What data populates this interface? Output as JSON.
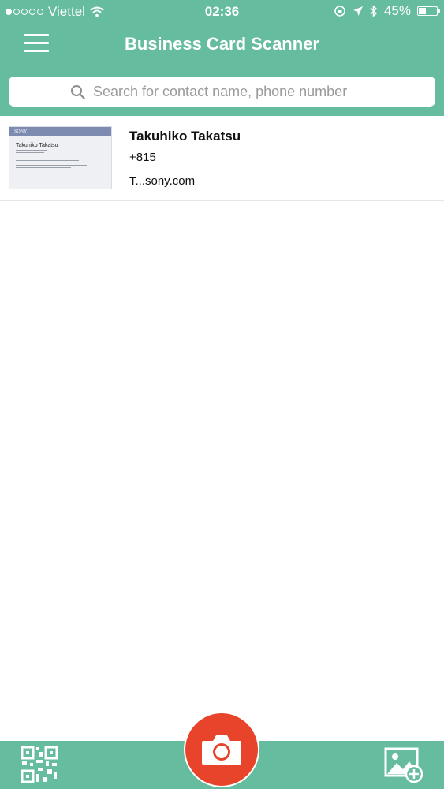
{
  "status_bar": {
    "carrier": "Viettel",
    "time": "02:36",
    "battery": "45%",
    "battery_level": 0.45
  },
  "header": {
    "title": "Business Card Scanner",
    "menu_icon": "hamburger-menu-icon"
  },
  "search": {
    "placeholder": "Search for contact name, phone number",
    "value": ""
  },
  "contacts": [
    {
      "name": "Takuhiko Takatsu",
      "phone": "+815",
      "email": "T...sony.com",
      "card_brand": "SONY",
      "card_name": "Takuhiko Takatsu"
    }
  ],
  "bottom_bar": {
    "qr_icon": "qr-code-icon",
    "camera_icon": "camera-icon",
    "gallery_icon": "add-image-icon"
  },
  "colors": {
    "primary": "#66bc9e",
    "accent": "#e8442b"
  }
}
